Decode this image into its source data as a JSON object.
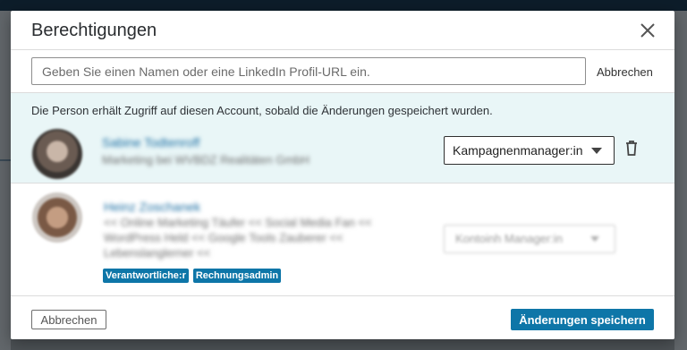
{
  "dialog": {
    "title": "Berechtigungen",
    "close_icon": "close-icon"
  },
  "search": {
    "placeholder": "Geben Sie einen Namen oder eine LinkedIn Profil-URL ein.",
    "value": "",
    "cancel_label": "Abbrechen"
  },
  "info_text": "Die Person erhält Zugriff auf diesen Account, sobald die Änderungen gespeichert wurden.",
  "members": [
    {
      "name": "Sabine Todtenroff",
      "subtitle": "Marketing bei WVBDZ Realitäten GmbH",
      "role": "Kampagnenmanager:in",
      "delete_icon": "trash-icon"
    },
    {
      "name": "Heinz Zoschanek",
      "subtitle": "<< Online Marketing Täufer << Social Media Fan << WordPress Held << Google Tools Zauberer << Lebenslanglerner <<",
      "role": "Kontoinh Manager:in",
      "badges": [
        "Verantwortliche:r",
        "Rechnungsadmin"
      ]
    }
  ],
  "footer": {
    "cancel_label": "Abbrechen",
    "save_label": "Änderungen speichern"
  },
  "colors": {
    "primary": "#0e76a8",
    "banner_bg": "#e9f6f7",
    "link": "#1d6fa3"
  }
}
